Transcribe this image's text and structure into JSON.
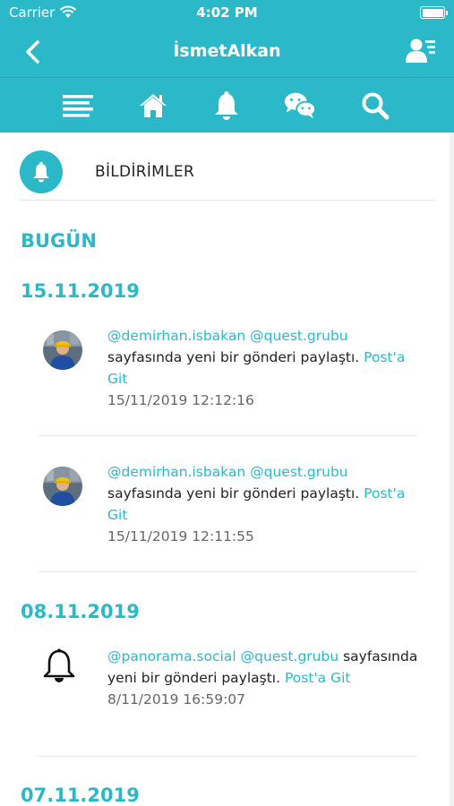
{
  "status_bar": {
    "carrier": "Carrier",
    "time": "4:02 PM"
  },
  "nav_bar": {
    "title": "İsmetAlkan"
  },
  "toolbar": {
    "icons": [
      "menu-icon",
      "home-icon",
      "bell-icon",
      "chat-icon",
      "search-icon"
    ]
  },
  "header": {
    "label": "BİLDİRİMLER"
  },
  "sections": {
    "today": "BUGÜN",
    "date1": "15.11.2019",
    "date2": "08.11.2019",
    "date3": "07.11.2019"
  },
  "notifications": [
    {
      "user": "@demirhan.isbakan",
      "page": "@quest.grubu",
      "message": "sayfasında yeni bir gönderi paylaştı.",
      "link": "Post'a Git",
      "timestamp": "15/11/2019 12:12:16"
    },
    {
      "user": "@demirhan.isbakan",
      "page": "@quest.grubu",
      "message": "sayfasında yeni bir gönderi paylaştı.",
      "link": "Post'a Git",
      "timestamp": "15/11/2019 12:11:55"
    },
    {
      "user": "@panorama.social",
      "page": "@quest.grubu",
      "message": "sayfasında yeni bir gönderi paylaştı.",
      "link": "Post'a Git",
      "timestamp": "8/11/2019 16:59:07"
    }
  ],
  "colors": {
    "accent": "#2bb9c9",
    "text": "#222222",
    "muted": "#666666"
  }
}
